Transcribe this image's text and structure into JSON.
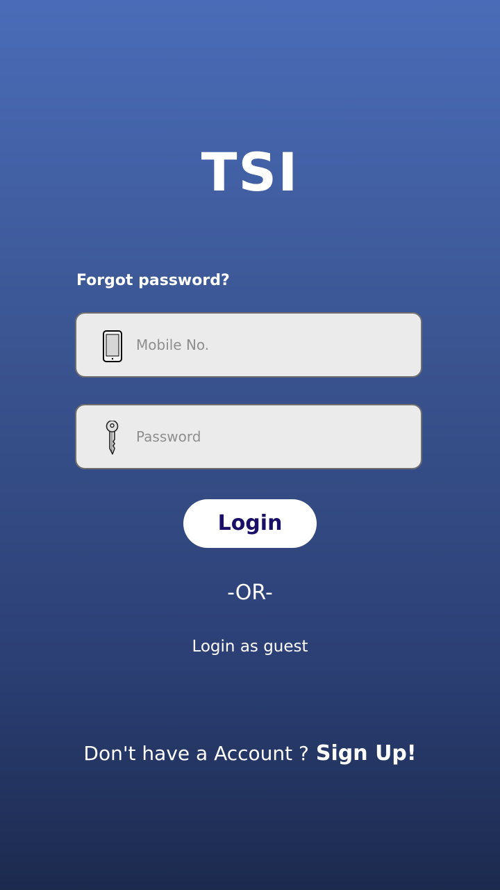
{
  "app": {
    "logo_text": "TSI"
  },
  "form": {
    "forgot_password_label": "Forgot password?",
    "mobile": {
      "placeholder": "Mobile No.",
      "value": "",
      "icon": "mobile-phone-icon"
    },
    "password": {
      "placeholder": "Password",
      "value": "",
      "icon": "key-icon"
    },
    "login_button_label": "Login",
    "or_separator": "-OR-",
    "guest_login_label": "Login as guest"
  },
  "footer": {
    "prompt_text": "Don't have a Account ?",
    "signup_label": "Sign Up!"
  },
  "colors": {
    "background_top": "#4a6cb8",
    "background_bottom": "#1c2a4e",
    "field_background": "#ebebeb",
    "login_button_text": "#1a0f66",
    "text": "#ffffff"
  }
}
